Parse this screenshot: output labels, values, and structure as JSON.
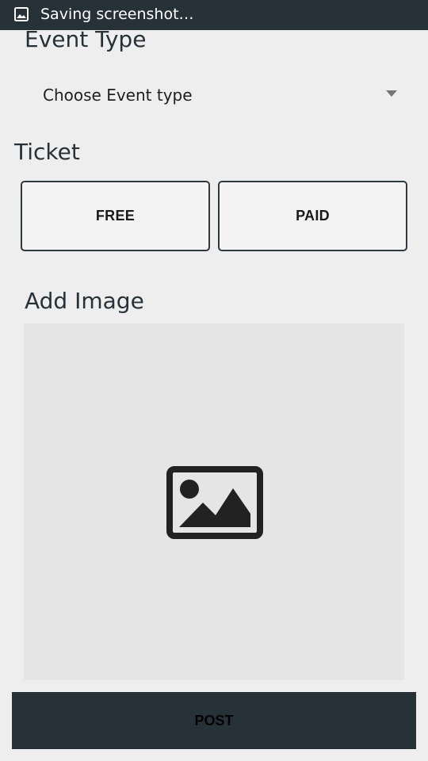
{
  "status_bar": {
    "notification_icon": "image-icon",
    "text": "Saving screenshot…"
  },
  "event_type": {
    "heading": "Event Type",
    "selected_value": "Choose Event type",
    "dropdown_icon": "dropdown-arrow-icon"
  },
  "ticket": {
    "heading": "Ticket",
    "free_label": "FREE",
    "paid_label": "PAID"
  },
  "add_image": {
    "heading": "Add Image",
    "placeholder_icon": "image-placeholder-icon"
  },
  "post": {
    "label": "POST"
  },
  "colors": {
    "status_bar": "#263238",
    "background": "#eeeeee",
    "image_area": "#e5e5e5",
    "post_button": "#263238"
  }
}
